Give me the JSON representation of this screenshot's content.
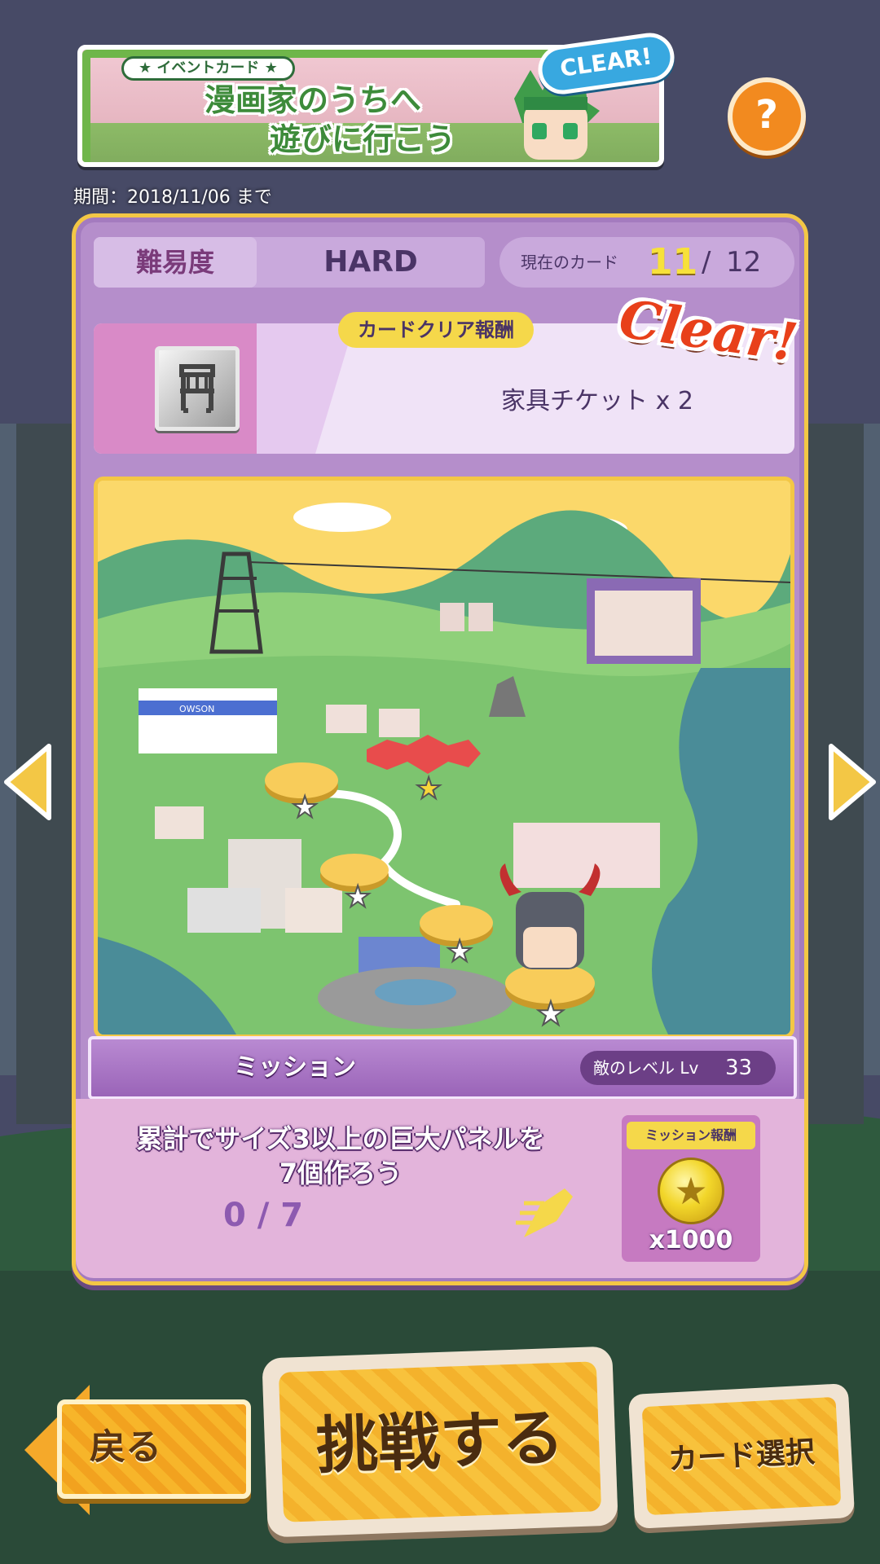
{
  "event": {
    "tag": "★ イベントカード ★",
    "title_line1": "漫画家のうちへ",
    "title_line2": "遊びに行こう",
    "clear_badge": "CLEAR!",
    "period": "期間：2018/11/06 まで"
  },
  "help": {
    "label": "?"
  },
  "card": {
    "difficulty_label": "難易度",
    "difficulty_value": "HARD",
    "current_card_label": "現在のカード",
    "current_card": "11",
    "separator": "/",
    "total_cards": "12",
    "reward_tag": "カードクリア報酬",
    "reward_text": "家具チケット x 2",
    "clear_stamp": "Clear!"
  },
  "mission": {
    "title": "ミッション",
    "enemy_level_label": "敵のレベル Lv",
    "enemy_level": "33",
    "text_line1": "累計でサイズ3以上の巨大パネルを",
    "text_line2": "7個作ろう",
    "progress": "0 / 7",
    "reward_tag": "ミッション報酬",
    "reward_count": "x1000"
  },
  "buttons": {
    "back": "戻る",
    "challenge": "挑戦する",
    "card_select": "カード選択"
  },
  "map": {
    "store_sign": "OWSON",
    "nodes": [
      {
        "state": "cleared"
      },
      {
        "state": "current"
      },
      {
        "state": "cleared"
      },
      {
        "state": "cleared"
      },
      {
        "state": "boss"
      }
    ]
  },
  "colors": {
    "panel": "#b58ecb",
    "panel_border": "#f3c745",
    "accent_yellow": "#f7e13a",
    "button_orange": "#f8c23c",
    "clear_red": "#e8401a"
  },
  "icons": [
    "help-icon",
    "chair-ticket-icon",
    "coin-icon",
    "pen-icon",
    "left-arrow-icon",
    "right-arrow-icon"
  ]
}
